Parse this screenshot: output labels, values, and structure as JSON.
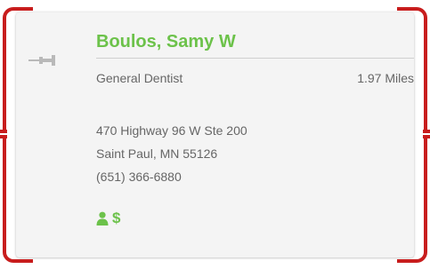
{
  "provider": {
    "name": "Boulos, Samy W",
    "specialty": "General Dentist",
    "distance": "1.97 Miles",
    "address_line1": "470 Highway 96 W Ste 200",
    "address_line2": "Saint Paul, MN 55126",
    "phone": "(651) 366-6880"
  },
  "icons": {
    "pin": "pushpin-icon",
    "person": "person-icon",
    "dollar": "dollar-icon",
    "dollar_glyph": "$"
  },
  "colors": {
    "accent_green": "#6cc24a",
    "annotation_red": "#c81d1d",
    "card_bg": "#f4f4f4",
    "text_gray": "#666666"
  }
}
